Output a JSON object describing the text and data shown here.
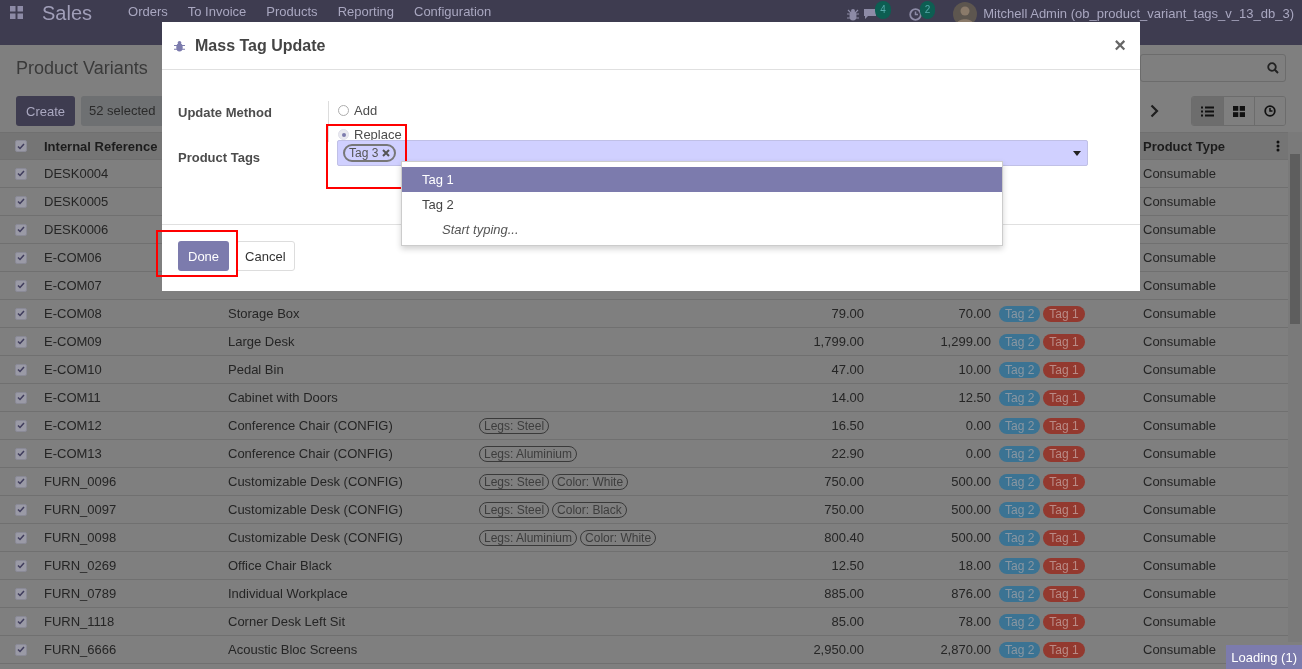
{
  "navbar": {
    "app": "Sales",
    "menu": [
      "Orders",
      "To Invoice",
      "Products",
      "Reporting",
      "Configuration"
    ],
    "badges": [
      "4",
      "2"
    ],
    "user": "Mitchell Admin (ob_product_variant_tags_v_13_db_3)"
  },
  "control_panel": {
    "title": "Product Variants",
    "create": "Create",
    "selection": "52 selected",
    "views": [
      {
        "kind": "list",
        "selected": true
      },
      {
        "kind": "kanban",
        "selected": false
      },
      {
        "kind": "activity",
        "selected": false
      }
    ]
  },
  "table": {
    "all_checked": true,
    "columns": [
      "Internal Reference",
      "Product Type"
    ],
    "rows": [
      {
        "checked": true,
        "ref": "DESK0004",
        "type": "Consumable"
      },
      {
        "checked": true,
        "ref": "DESK0005",
        "type": "Consumable"
      },
      {
        "checked": true,
        "ref": "DESK0006",
        "type": "Consumable"
      },
      {
        "checked": true,
        "ref": "E-COM06",
        "type": "Consumable"
      },
      {
        "checked": true,
        "ref": "E-COM07",
        "type": "Consumable"
      },
      {
        "checked": true,
        "ref": "E-COM08",
        "name": "Storage Box",
        "attributes": [],
        "sale": "79.00",
        "cost": "70.00",
        "tags": [
          {
            "label": "Tag 2",
            "color": "#3b7393"
          },
          {
            "label": "Tag 1",
            "color": "#93392f"
          }
        ],
        "type": "Consumable"
      },
      {
        "checked": true,
        "ref": "E-COM09",
        "name": "Large Desk",
        "attributes": [],
        "sale": "1,799.00",
        "cost": "1,299.00",
        "tags": [
          {
            "label": "Tag 2",
            "color": "#3b7393"
          },
          {
            "label": "Tag 1",
            "color": "#93392f"
          }
        ],
        "type": "Consumable"
      },
      {
        "checked": true,
        "ref": "E-COM10",
        "name": "Pedal Bin",
        "attributes": [],
        "sale": "47.00",
        "cost": "10.00",
        "tags": [
          {
            "label": "Tag 2",
            "color": "#3b7393"
          },
          {
            "label": "Tag 1",
            "color": "#93392f"
          }
        ],
        "type": "Consumable"
      },
      {
        "checked": true,
        "ref": "E-COM11",
        "name": "Cabinet with Doors",
        "attributes": [],
        "sale": "14.00",
        "cost": "12.50",
        "tags": [
          {
            "label": "Tag 2",
            "color": "#3b7393"
          },
          {
            "label": "Tag 1",
            "color": "#93392f"
          }
        ],
        "type": "Consumable"
      },
      {
        "checked": true,
        "ref": "E-COM12",
        "name": "Conference Chair (CONFIG)",
        "attributes": [
          "Legs: Steel"
        ],
        "sale": "16.50",
        "cost": "0.00",
        "tags": [
          {
            "label": "Tag 2",
            "color": "#3b7393"
          },
          {
            "label": "Tag 1",
            "color": "#93392f"
          }
        ],
        "type": "Consumable"
      },
      {
        "checked": true,
        "ref": "E-COM13",
        "name": "Conference Chair (CONFIG)",
        "attributes": [
          "Legs: Aluminium"
        ],
        "sale": "22.90",
        "cost": "0.00",
        "tags": [
          {
            "label": "Tag 2",
            "color": "#3b7393"
          },
          {
            "label": "Tag 1",
            "color": "#93392f"
          }
        ],
        "type": "Consumable"
      },
      {
        "checked": true,
        "ref": "FURN_0096",
        "name": "Customizable Desk (CONFIG)",
        "attributes": [
          "Legs: Steel",
          "Color: White"
        ],
        "sale": "750.00",
        "cost": "500.00",
        "tags": [
          {
            "label": "Tag 2",
            "color": "#3b7393"
          },
          {
            "label": "Tag 1",
            "color": "#93392f"
          }
        ],
        "type": "Consumable"
      },
      {
        "checked": true,
        "ref": "FURN_0097",
        "name": "Customizable Desk (CONFIG)",
        "attributes": [
          "Legs: Steel",
          "Color: Black"
        ],
        "sale": "750.00",
        "cost": "500.00",
        "tags": [
          {
            "label": "Tag 2",
            "color": "#3b7393"
          },
          {
            "label": "Tag 1",
            "color": "#93392f"
          }
        ],
        "type": "Consumable"
      },
      {
        "checked": true,
        "ref": "FURN_0098",
        "name": "Customizable Desk (CONFIG)",
        "attributes": [
          "Legs: Aluminium",
          "Color: White"
        ],
        "sale": "800.40",
        "cost": "500.00",
        "tags": [
          {
            "label": "Tag 2",
            "color": "#3b7393"
          },
          {
            "label": "Tag 1",
            "color": "#93392f"
          }
        ],
        "type": "Consumable"
      },
      {
        "checked": true,
        "ref": "FURN_0269",
        "name": "Office Chair Black",
        "attributes": [],
        "sale": "12.50",
        "cost": "18.00",
        "tags": [
          {
            "label": "Tag 2",
            "color": "#3b7393"
          },
          {
            "label": "Tag 1",
            "color": "#93392f"
          }
        ],
        "type": "Consumable"
      },
      {
        "checked": true,
        "ref": "FURN_0789",
        "name": "Individual Workplace",
        "attributes": [],
        "sale": "885.00",
        "cost": "876.00",
        "tags": [
          {
            "label": "Tag 2",
            "color": "#3b7393"
          },
          {
            "label": "Tag 1",
            "color": "#93392f"
          }
        ],
        "type": "Consumable"
      },
      {
        "checked": true,
        "ref": "FURN_1118",
        "name": "Corner Desk Left Sit",
        "attributes": [],
        "sale": "85.00",
        "cost": "78.00",
        "tags": [
          {
            "label": "Tag 2",
            "color": "#3b7393"
          },
          {
            "label": "Tag 1",
            "color": "#93392f"
          }
        ],
        "type": "Consumable"
      },
      {
        "checked": true,
        "ref": "FURN_6666",
        "name": "Acoustic Bloc Screens",
        "attributes": [],
        "sale": "2,950.00",
        "cost": "2,870.00",
        "tags": [
          {
            "label": "Tag 2",
            "color": "#3b7393"
          },
          {
            "label": "Tag 1",
            "color": "#93392f"
          }
        ],
        "type": "Consumable"
      }
    ]
  },
  "dialog": {
    "title": "Mass Tag Update",
    "close": "×",
    "update_method": {
      "label": "Update Method",
      "options": [
        {
          "label": "Add",
          "selected": false
        },
        {
          "label": "Replace",
          "selected": true
        }
      ]
    },
    "product_tags": {
      "label": "Product Tags",
      "tags": [
        "Tag 3"
      ],
      "dropdown": [
        {
          "label": "Tag 1",
          "selected": true
        },
        {
          "label": "Tag 2",
          "selected": false
        }
      ],
      "hint": "Start typing..."
    },
    "buttons": [
      "Done",
      "Cancel"
    ]
  },
  "loading": "Loading (1)"
}
